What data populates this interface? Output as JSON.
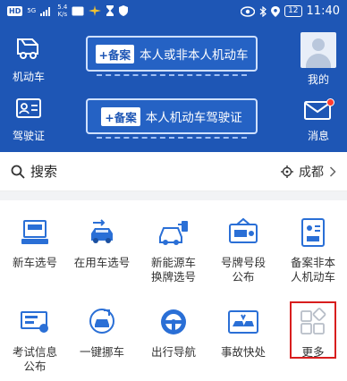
{
  "status_bar": {
    "left_badge": "HD",
    "signal": "5G",
    "speed_value": "5.4",
    "speed_unit": "K/s",
    "battery": "12",
    "time": "11:40"
  },
  "header": {
    "vehicle_label": "机动车",
    "license_label": "驾驶证",
    "profile_label": "我的",
    "message_label": "消息",
    "banner_1": {
      "tag": "+备案",
      "text": "本人或非本人机动车"
    },
    "banner_2": {
      "tag": "+备案",
      "text": "本人机动车驾驶证"
    }
  },
  "search": {
    "label": "搜索",
    "city": "成都"
  },
  "grid": {
    "item_1": "新车选号",
    "item_2": "在用车选号",
    "item_3": "新能源车\n换牌选号",
    "item_4": "号牌号段\n公布",
    "item_5": "备案非本\n人机动车",
    "item_6": "考试信息\n公布",
    "item_7": "一键挪车",
    "item_8": "出行导航",
    "item_9": "事故快处",
    "item_10": "更多"
  },
  "colors": {
    "primary_blue": "#1e56b5",
    "highlight_red": "#d81e1e",
    "badge_red": "#ff3b30"
  }
}
